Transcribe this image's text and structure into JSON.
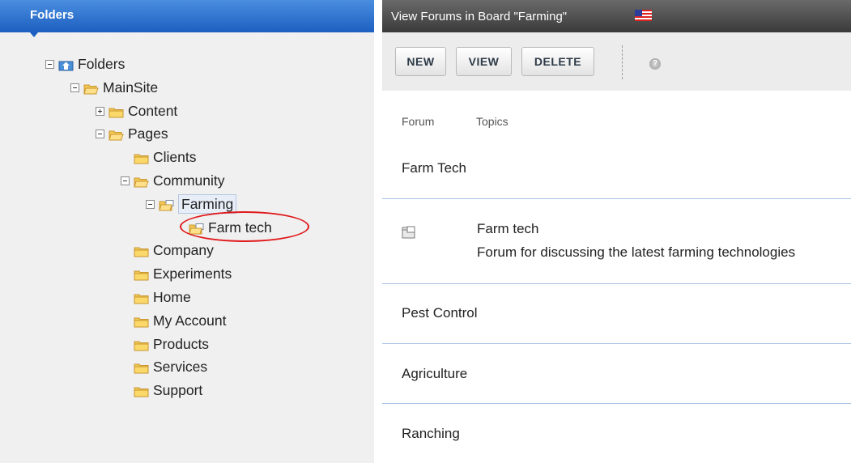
{
  "folders_panel": {
    "title": "Folders",
    "tree": [
      {
        "label": "Folders",
        "expander": "minus",
        "icon": "home-folder-icon",
        "depth": 0
      },
      {
        "label": "MainSite",
        "expander": "minus",
        "icon": "open-folder-icon",
        "depth": 1
      },
      {
        "label": "Content",
        "expander": "plus",
        "icon": "folder-icon",
        "depth": 2
      },
      {
        "label": "Pages",
        "expander": "minus",
        "icon": "open-folder-icon",
        "depth": 2
      },
      {
        "label": "Clients",
        "expander": "none",
        "icon": "folder-icon",
        "depth": 3
      },
      {
        "label": "Community",
        "expander": "minus",
        "icon": "open-folder-icon",
        "depth": 3
      },
      {
        "label": "Farming",
        "expander": "minus",
        "icon": "forum-board-folder-icon",
        "depth": 4,
        "selected": true
      },
      {
        "label": "Farm tech",
        "expander": "none",
        "icon": "forum-folder-icon",
        "depth": 5,
        "highlighted": true
      },
      {
        "label": "Company",
        "expander": "none",
        "icon": "folder-icon",
        "depth": 3
      },
      {
        "label": "Experiments",
        "expander": "none",
        "icon": "folder-icon",
        "depth": 3
      },
      {
        "label": "Home",
        "expander": "none",
        "icon": "folder-icon",
        "depth": 3
      },
      {
        "label": "My Account",
        "expander": "none",
        "icon": "folder-icon",
        "depth": 3
      },
      {
        "label": "Products",
        "expander": "none",
        "icon": "folder-icon",
        "depth": 3
      },
      {
        "label": "Services",
        "expander": "none",
        "icon": "folder-icon",
        "depth": 3
      },
      {
        "label": "Support",
        "expander": "none",
        "icon": "folder-icon",
        "depth": 3
      }
    ]
  },
  "content_panel": {
    "title": "View Forums in Board \"Farming\"",
    "language_flag": "us-flag-icon",
    "toolbar": {
      "new_label": "NEW",
      "view_label": "VIEW",
      "delete_label": "DELETE",
      "help_icon": "help-icon"
    },
    "columns": [
      "Forum",
      "Topics"
    ],
    "rows": [
      {
        "type": "category",
        "label": "Farm Tech"
      },
      {
        "type": "forum",
        "name": "Farm tech",
        "description": "Forum for discussing the latest farming technologies"
      },
      {
        "type": "category",
        "label": "Pest Control"
      },
      {
        "type": "category",
        "label": "Agriculture"
      },
      {
        "type": "category",
        "label": "Ranching"
      }
    ]
  },
  "colors": {
    "folders_header": "#1c5fc0",
    "content_header": "#3a3a3a",
    "row_separator": "#a9c3e3",
    "annotation_circle": "#e0191b",
    "folder_yellow": "#f3c955"
  }
}
